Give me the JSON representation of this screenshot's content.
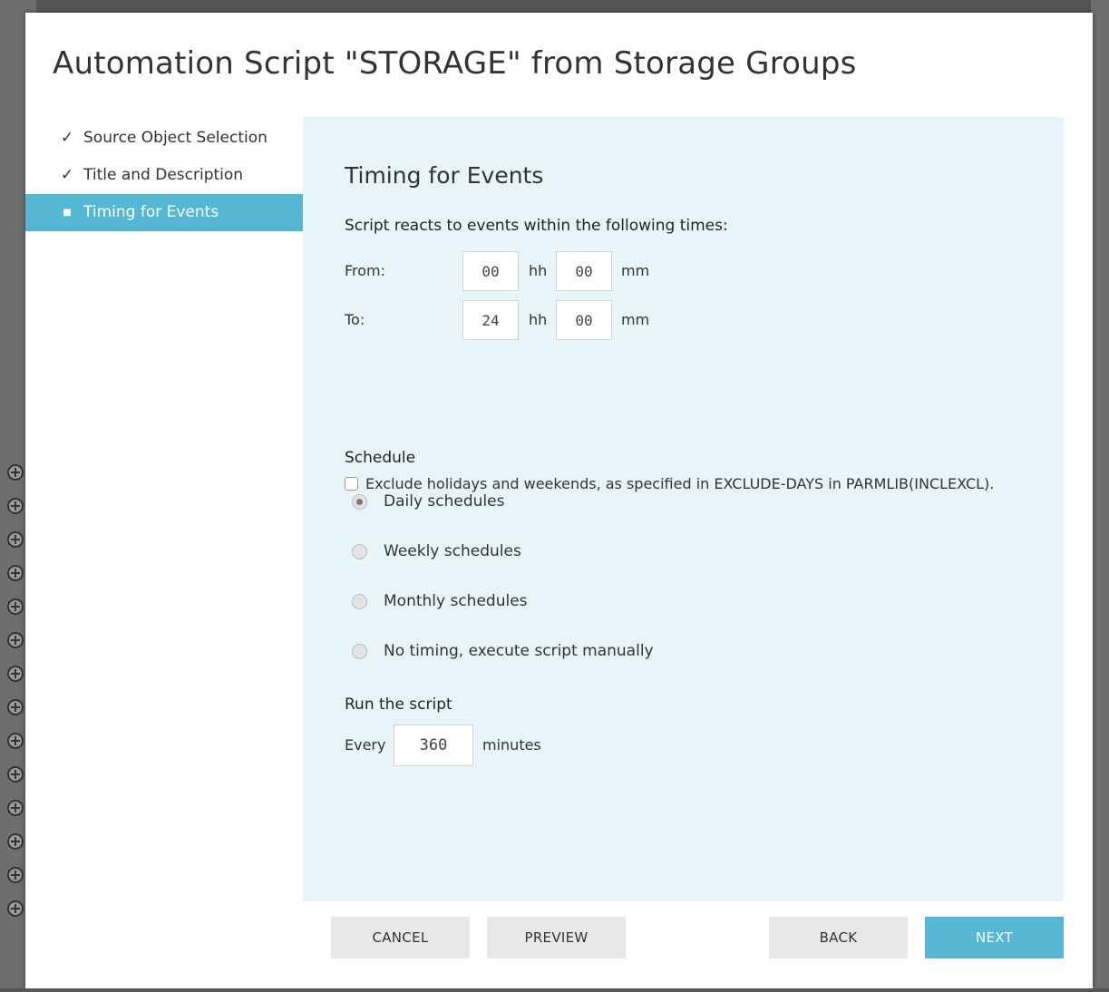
{
  "modal": {
    "title": "Automation Script \"STORAGE\" from Storage Groups"
  },
  "steps": [
    {
      "mark": "✓",
      "label": "Source Object Selection",
      "state": "done"
    },
    {
      "mark": "✓",
      "label": "Title and Description",
      "state": "done"
    },
    {
      "mark": "■",
      "label": "Timing for Events",
      "state": "active"
    }
  ],
  "panel": {
    "title": "Timing for Events",
    "times_heading": "Script reacts to events within the following times:",
    "from": {
      "label": "From:",
      "hh": "00",
      "mm": "00"
    },
    "to": {
      "label": "To:",
      "hh": "24",
      "mm": "00"
    },
    "hh_unit": "hh",
    "mm_unit": "mm",
    "exclude_label": "Exclude holidays and weekends, as specified in EXCLUDE-DAYS in PARMLIB(INCLEXCL).",
    "exclude_checked": false,
    "schedule_heading": "Schedule",
    "schedule_options": [
      {
        "label": "Daily schedules",
        "checked": true
      },
      {
        "label": "Weekly schedules",
        "checked": false
      },
      {
        "label": "Monthly schedules",
        "checked": false
      },
      {
        "label": "No timing, execute script manually",
        "checked": false
      }
    ],
    "run_heading": "Run the script",
    "run_every_label": "Every",
    "run_every_value": "360",
    "run_unit": "minutes"
  },
  "buttons": {
    "cancel": "CANCEL",
    "preview": "PREVIEW",
    "back": "BACK",
    "next": "NEXT"
  },
  "colors": {
    "accent": "#55b7d3",
    "panel_bg": "#e8f5f8",
    "button_bg": "#e8e8e8"
  }
}
